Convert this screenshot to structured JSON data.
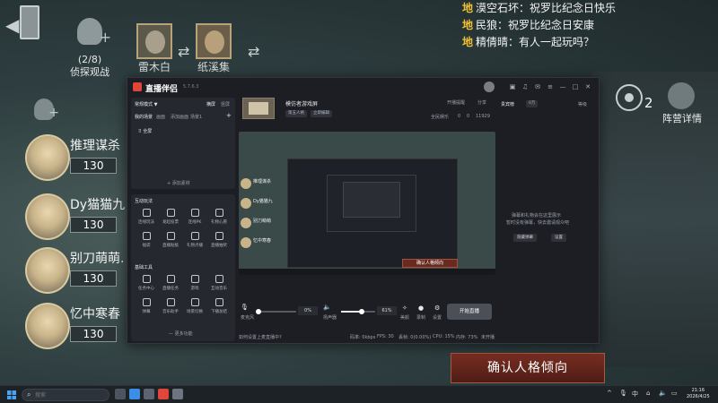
{
  "game": {
    "spectate": {
      "count": "(2/8)",
      "label": "侦探观战"
    },
    "characters": [
      {
        "name": "雷木白"
      },
      {
        "name": "纸溪集"
      }
    ],
    "team": [
      {
        "name": "推理谋杀",
        "level": "130"
      },
      {
        "name": "Dy猫猫九",
        "level": "130"
      },
      {
        "name": "别刀萌萌.",
        "level": "130"
      },
      {
        "name": "忆中寒春",
        "level": "130"
      }
    ],
    "chat": [
      {
        "tag": "地",
        "text": "漠空石坏：祝罗比纪念日快乐"
      },
      {
        "tag": "地",
        "text": "民狼：祝罗比纪念日安康"
      },
      {
        "tag": "地",
        "text": "精倩晴：有人一起玩吗？"
      }
    ],
    "camp": {
      "count": "2",
      "label": "阵营详情"
    },
    "confirm_button": "确认人格倾向"
  },
  "app": {
    "title": "直播伴侣",
    "version": "5.7.6.3",
    "left": {
      "mode": "常规模式 ▼",
      "tabs": [
        "横屏",
        "竖屏"
      ],
      "scene_tabs": [
        "我的场景",
        "画面",
        "添加画面",
        "场景1"
      ],
      "scene_item": "全屏",
      "add_material": "+ 添加素材",
      "interactive_title": "互动玩法",
      "interactive_tools": [
        "连线玩法",
        "发起投票",
        "连线PK",
        "礼物心愿",
        "福袋",
        "直播贴纸",
        "礼物点播",
        "直播抽奖"
      ],
      "basic_title": "基础工具",
      "basic_tools": [
        "任务中心",
        "直播任务",
        "游戏",
        "互动音乐",
        "弹幕",
        "音乐助手",
        "场景切换",
        "下播总结"
      ],
      "more": "— 更多功能"
    },
    "stream_info": {
      "title": "模仿者游戏屏",
      "tags": [
        "第五人格",
        "立即编辑"
      ],
      "open_notice": "开播提醒",
      "share": "分享",
      "stats": [
        "全民娱乐",
        "0",
        "0",
        "11929"
      ]
    },
    "preview": {
      "mini_names": [
        "推理谋杀",
        "Dy猫猫九",
        "别刀萌萌",
        "忆中寒春"
      ],
      "confirm": "确认人格倾向"
    },
    "controls": {
      "mic_label": "麦克风",
      "mic_pct": "0%",
      "spk_label": "扬声器",
      "spk_pct": "61%",
      "tools": [
        "美颜",
        "录制",
        "设置"
      ],
      "go_live": "开始直播"
    },
    "status": [
      "如何设置上麦直播中?",
      "码率: 0kbps",
      "FPS: 30",
      "丢帧: 0(0.00%)",
      "CPU: 15%",
      "内存: 73%",
      "未开播"
    ],
    "right": {
      "tabs": [
        "贵宾榜",
        "0万",
        "等级"
      ],
      "empty_tip": "弹幕和礼物会在这里展示",
      "empty_tip2": "暂时没有弹幕，快去邀请观众吧",
      "buttons": [
        "隐藏弹幕",
        "设置"
      ]
    }
  },
  "taskbar": {
    "search_placeholder": "搜索",
    "tray": [
      "^",
      "中"
    ],
    "time": "21:16",
    "date": "2026/4/25"
  }
}
